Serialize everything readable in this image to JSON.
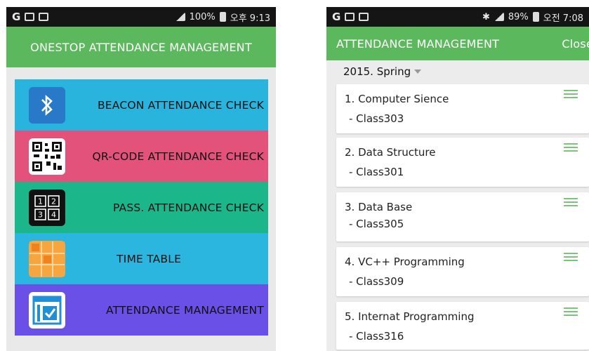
{
  "left_phone": {
    "status": {
      "carrier_icon": "G",
      "right_text": "100%",
      "time": "오후 9:13"
    },
    "title": "ONESTOP ATTENDANCE MANAGEMENT",
    "menu": [
      {
        "label": "BEACON ATTENDANCE CHECK",
        "icon": "bluetooth-icon",
        "color": "#28b4dd"
      },
      {
        "label": "QR-CODE ATTENDANCE CHECK",
        "icon": "qr-code-icon",
        "color": "#e2527a"
      },
      {
        "label": "PASS. ATTENDANCE CHECK",
        "icon": "number-pad-icon",
        "color": "#1bb68a"
      },
      {
        "label": "TIME TABLE",
        "icon": "timetable-icon",
        "color": "#2bb6e0"
      },
      {
        "label": "ATTENDANCE MANAGEMENT",
        "icon": "calendar-check-icon",
        "color": "#6a50e6"
      }
    ]
  },
  "right_phone": {
    "status": {
      "carrier_icon": "G",
      "right_text": "89%",
      "time": "오전 7:08"
    },
    "title": "ATTENDANCE MANAGEMENT",
    "close_label": "Close",
    "semester": "2015. Spring",
    "courses": [
      {
        "title": "1. Computer Sience",
        "room": "- Class303"
      },
      {
        "title": "2. Data Structure",
        "room": "- Class301"
      },
      {
        "title": "3. Data Base",
        "room": "- Class305"
      },
      {
        "title": "4. VC++ Programming",
        "room": "- Class309"
      },
      {
        "title": "5. Internat Programming",
        "room": "- Class316"
      }
    ]
  },
  "colors": {
    "appbar": "#5cb85c",
    "statusbar": "#151515"
  }
}
